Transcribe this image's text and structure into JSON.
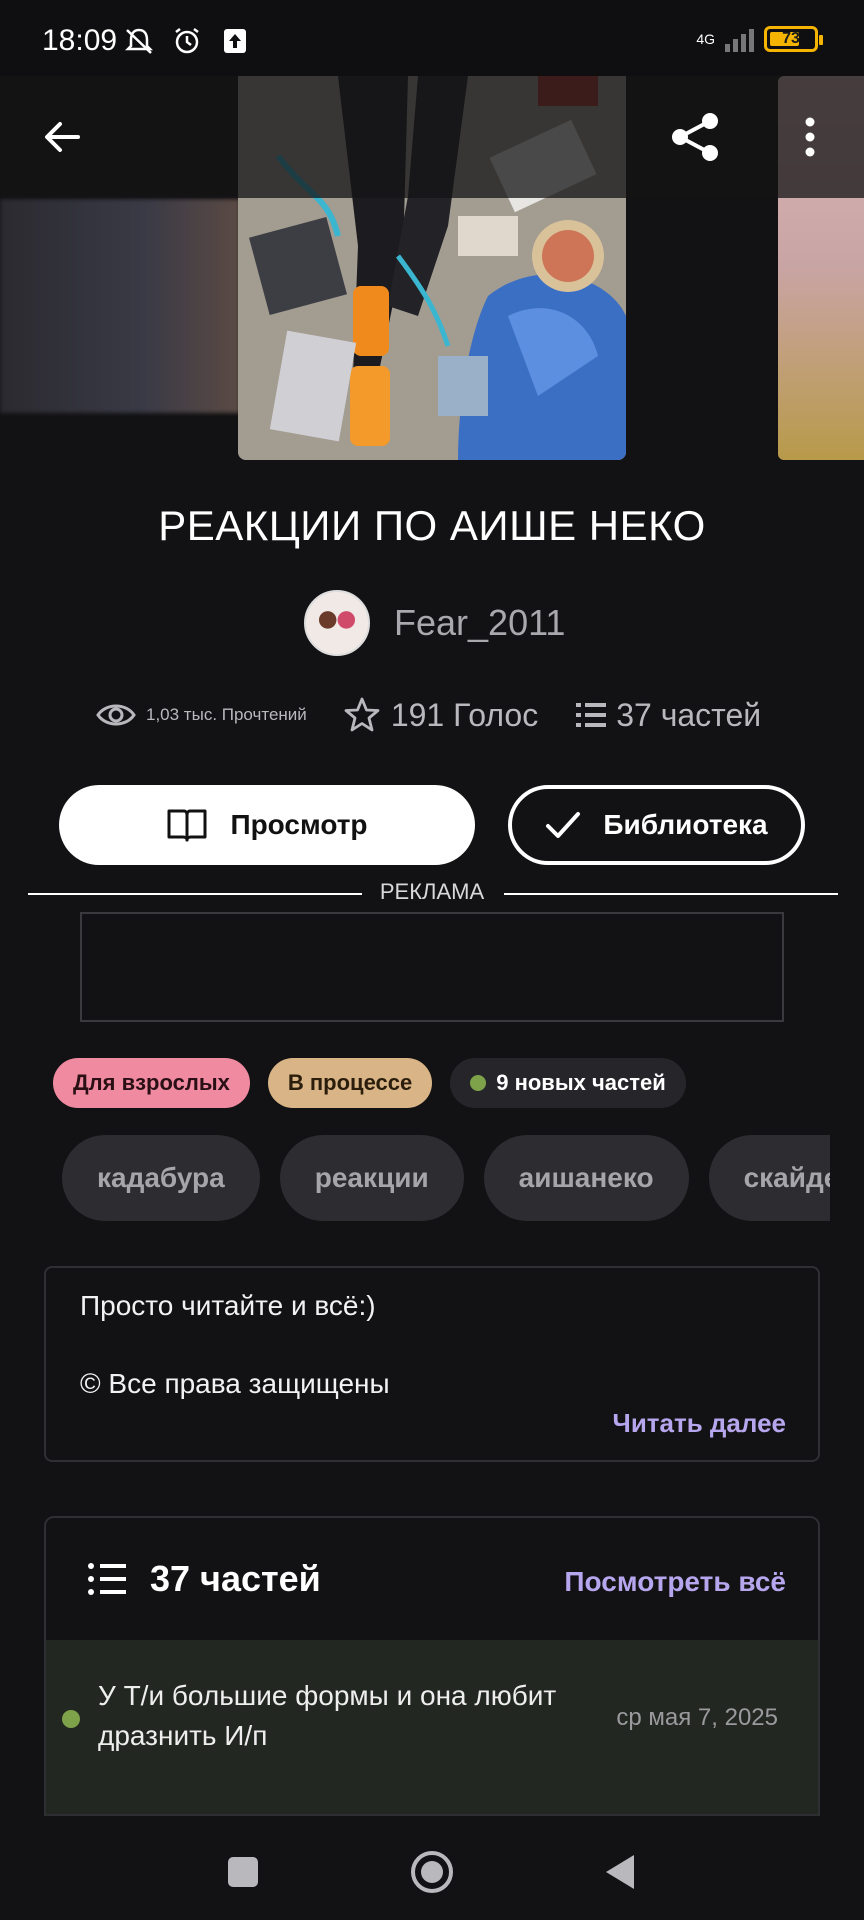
{
  "status_bar": {
    "time": "18:09",
    "network": "4G",
    "battery": "73"
  },
  "book": {
    "title": "РЕАКЦИИ ПО АИШЕ НЕКО",
    "author": "Fear_2011",
    "reads": "1,03 тыс. Прочтений",
    "votes": "191 Голос",
    "parts": "37 частей"
  },
  "actions": {
    "view_label": "Просмотр",
    "library_label": "Библиотека"
  },
  "ad": {
    "label": "РЕКЛАМА"
  },
  "badges": {
    "adult": "Для взрослых",
    "status": "В процессе",
    "new_parts": "9 новых частей"
  },
  "tags": [
    "кадабура",
    "реакции",
    "аишанеко",
    "скайдер"
  ],
  "description": {
    "line1": "Просто читайте и всё:)",
    "line2": "© Все права защищены",
    "read_more": "Читать далее"
  },
  "parts_section": {
    "title": "37 частей",
    "see_all": "Посмотреть всё",
    "items": [
      {
        "title": "У Т/и большие формы и она любит дразнить И/п",
        "date": "ср мая 7, 2025"
      }
    ]
  },
  "icons": [
    "back-arrow-icon",
    "share-icon",
    "more-vertical-icon",
    "eye-icon",
    "star-icon",
    "list-icon",
    "book-icon",
    "check-icon"
  ]
}
